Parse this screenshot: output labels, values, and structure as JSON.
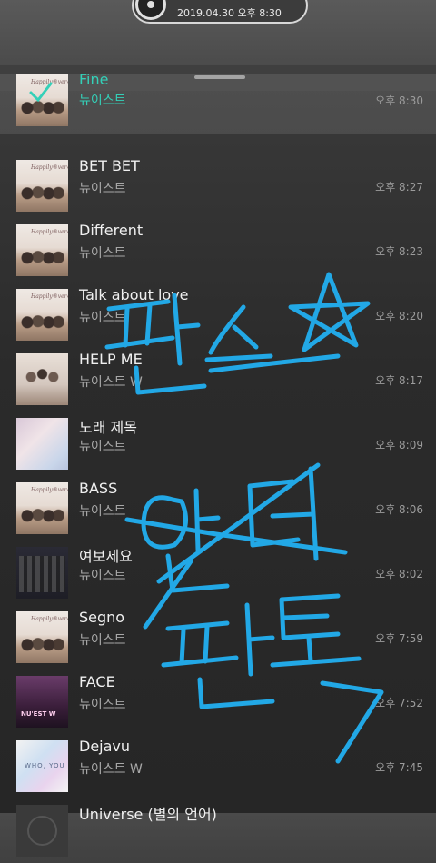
{
  "header": {
    "date": "2019.04.30 오후 8:30"
  },
  "songs": [
    {
      "title": "Fine",
      "artist": "뉴이스트",
      "time": "오후 8:30",
      "cover": "cover-a",
      "active": true
    },
    {
      "title": "BET BET",
      "artist": "뉴이스트",
      "time": "오후 8:27",
      "cover": "cover-a"
    },
    {
      "title": "Different",
      "artist": "뉴이스트",
      "time": "오후 8:23",
      "cover": "cover-a"
    },
    {
      "title": "Talk about love",
      "artist": "뉴이스트",
      "time": "오후 8:20",
      "cover": "cover-a"
    },
    {
      "title": "HELP ME",
      "artist": "뉴이스트 W",
      "time": "오후 8:17",
      "cover": "cover-b"
    },
    {
      "title": "노래 제목",
      "artist": "뉴이스트",
      "time": "오후 8:09",
      "cover": "cover-c"
    },
    {
      "title": "BASS",
      "artist": "뉴이스트",
      "time": "오후 8:06",
      "cover": "cover-a"
    },
    {
      "title": "여보세요",
      "artist": "뉴이스트",
      "time": "오후 8:02",
      "cover": "cover-d"
    },
    {
      "title": "Segno",
      "artist": "뉴이스트",
      "time": "오후 7:59",
      "cover": "cover-a"
    },
    {
      "title": "FACE",
      "artist": "뉴이스트",
      "time": "오후 7:52",
      "cover": "cover-e"
    },
    {
      "title": "Dejavu",
      "artist": "뉴이스트 W",
      "time": "오후 7:45",
      "cover": "cover-f"
    },
    {
      "title": "Universe (별의 언어)",
      "artist": "",
      "time": "",
      "cover": "cover-g"
    }
  ],
  "colors": {
    "active_text": "#34d0b8",
    "annotation_ink": "#22a8e6"
  }
}
